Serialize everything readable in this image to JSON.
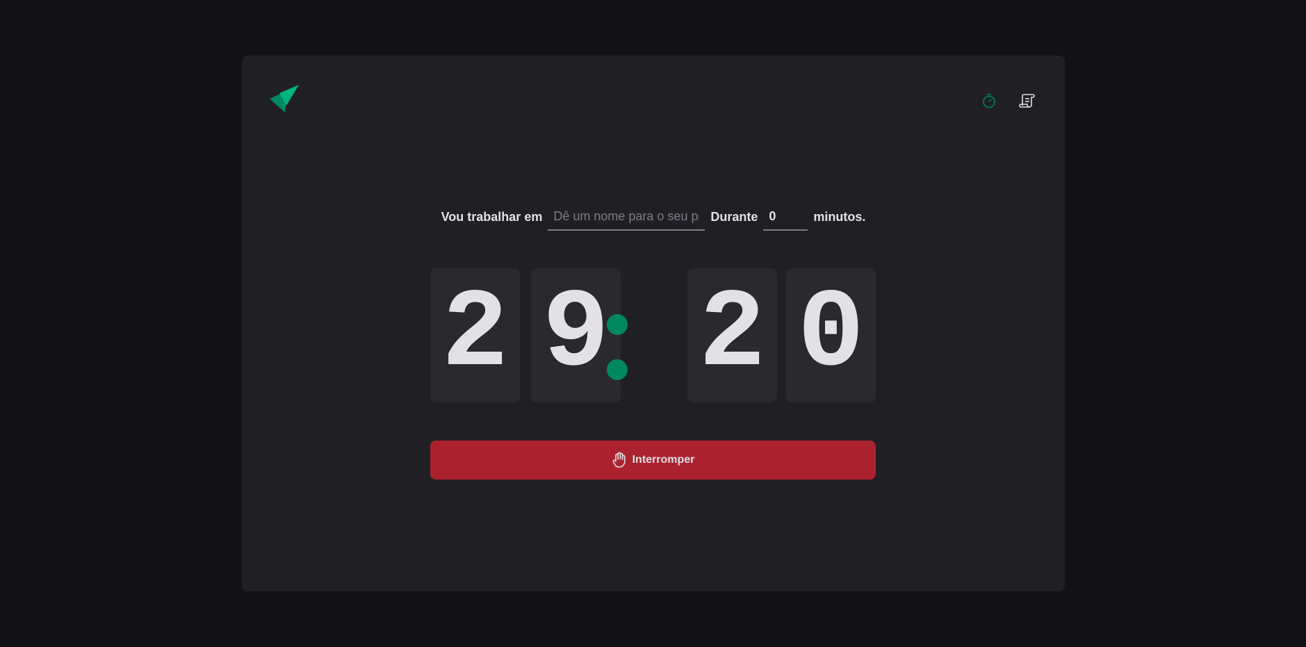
{
  "header": {
    "logo_icon": "ignite-timer-logo",
    "nav": [
      {
        "icon": "timer-icon",
        "color": "#00875f",
        "active": true
      },
      {
        "icon": "scroll-icon",
        "color": "#e1e1e6",
        "active": false
      }
    ]
  },
  "form": {
    "task_label": "Vou trabalhar em",
    "task_placeholder": "Dê um nome para o seu projeto",
    "task_value": "",
    "duration_label": "Durante",
    "minutes_value": "0",
    "minutes_suffix": "minutos."
  },
  "countdown": {
    "minutes_tens": "2",
    "minutes_units": "9",
    "separator": ":",
    "seconds_tens": "2",
    "seconds_units": "0"
  },
  "stop_button": {
    "label": "Interromper",
    "icon": "hand-palm-icon"
  },
  "colors": {
    "background": "#121214",
    "panel": "#202024",
    "digit_box": "#29292e",
    "accent": "#00875f",
    "danger": "#ab222e",
    "text": "#e1e1e6",
    "placeholder": "#7c7c8a"
  }
}
